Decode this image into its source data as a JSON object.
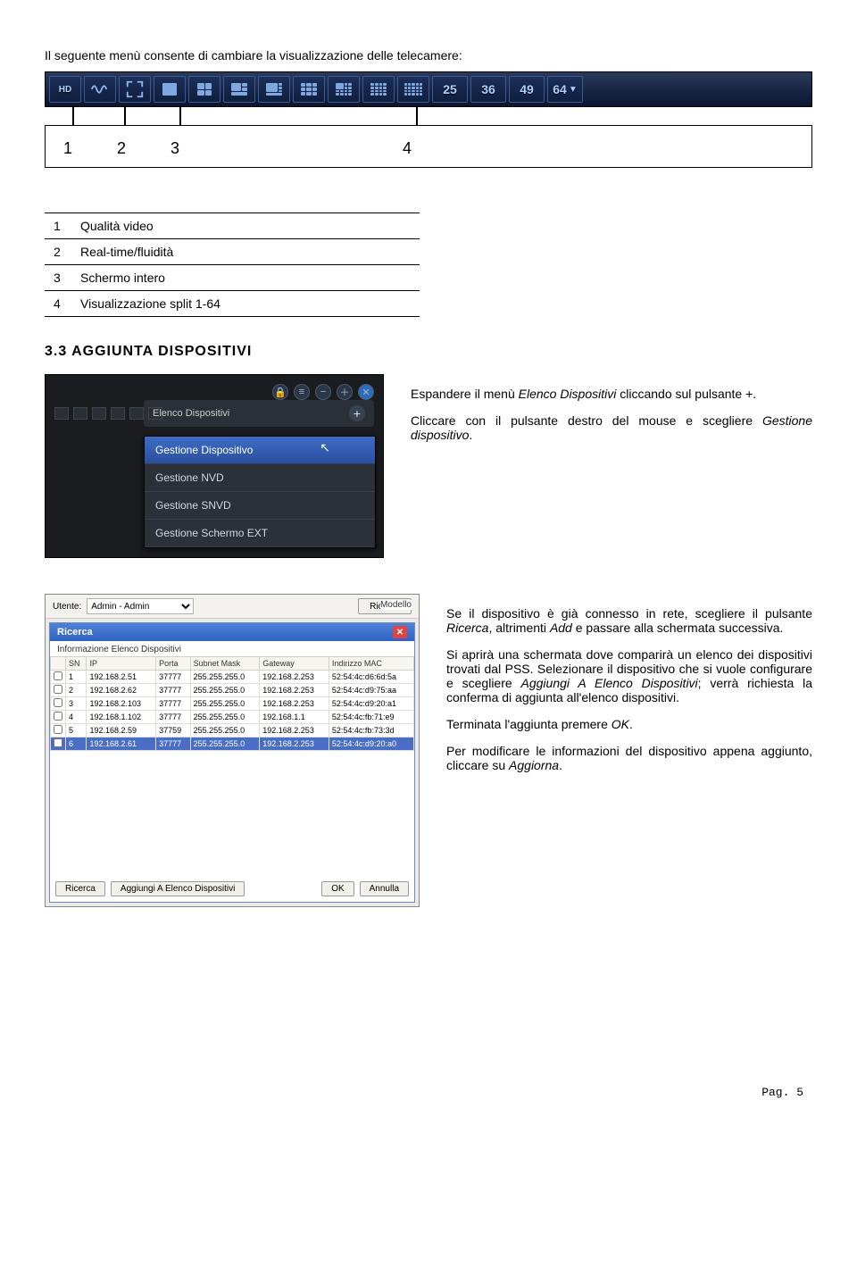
{
  "intro": "Il seguente menù consente di cambiare la visualizzazione delle telecamere:",
  "toolbar": {
    "hd": "HD",
    "numbers": [
      "25",
      "36",
      "49",
      "64"
    ]
  },
  "labels": {
    "n1": "1",
    "n2": "2",
    "n3": "3",
    "n4": "4"
  },
  "legend": [
    {
      "n": "1",
      "t": "Qualità video"
    },
    {
      "n": "2",
      "t": "Real-time/fluidità"
    },
    {
      "n": "3",
      "t": "Schermo intero"
    },
    {
      "n": "4",
      "t": "Visualizzazione split 1-64"
    }
  ],
  "sect_title": "3.3 AGGIUNTA DISPOSITIVI",
  "para1a": "Espandere il menù ",
  "para1b": "Elenco Dispositivi",
  "para1c": " cliccando sul pulsante +.",
  "para2a": "Cliccare con il pulsante destro del mouse e scegliere ",
  "para2b": "Gestione dispositivo",
  "para2c": ".",
  "elenco_head": "Elenco Dispositivi",
  "ctx": [
    "Gestione Dispositivo",
    "Gestione NVD",
    "Gestione SNVD",
    "Gestione Schermo EXT"
  ],
  "win": {
    "utente_label": "Utente:",
    "utente_val": "Admin - Admin",
    "ricerca_btn": "Ricerca",
    "modello": "Modello"
  },
  "dlg": {
    "title": "Ricerca",
    "subtitle": "Informazione Elenco Dispositivi",
    "headers": [
      "SN",
      "IP",
      "Porta",
      "Subnet Mask",
      "Gateway",
      "Indirizzo MAC"
    ],
    "rows": [
      {
        "sn": "1",
        "ip": "192.168.2.51",
        "port": "37777",
        "mask": "255.255.255.0",
        "gw": "192.168.2.253",
        "mac": "52:54:4c:d6:6d:5a"
      },
      {
        "sn": "2",
        "ip": "192.168.2.62",
        "port": "37777",
        "mask": "255.255.255.0",
        "gw": "192.168.2.253",
        "mac": "52:54:4c:d9:75:aa"
      },
      {
        "sn": "3",
        "ip": "192.168.2.103",
        "port": "37777",
        "mask": "255.255.255.0",
        "gw": "192.168.2.253",
        "mac": "52:54:4c:d9:20:a1"
      },
      {
        "sn": "4",
        "ip": "192.168.1.102",
        "port": "37777",
        "mask": "255.255.255.0",
        "gw": "192.168.1.1",
        "mac": "52:54:4c:fb:71:e9"
      },
      {
        "sn": "5",
        "ip": "192.168.2.59",
        "port": "37759",
        "mask": "255.255.255.0",
        "gw": "192.168.2.253",
        "mac": "52:54:4c:fb:73:3d"
      },
      {
        "sn": "6",
        "ip": "192.168.2.61",
        "port": "37777",
        "mask": "255.255.255.0",
        "gw": "192.168.2.253",
        "mac": "52:54:4c:d9:20:a0"
      }
    ],
    "btn_ricerca": "Ricerca",
    "btn_aggiungi": "Aggiungi A Elenco Dispositivi",
    "btn_ok": "OK",
    "btn_annulla": "Annulla"
  },
  "p3_parts": [
    "Se il dispositivo è già connesso in rete, scegliere il pulsante ",
    "Ricerca",
    ", altrimenti ",
    "Add",
    " e passare alla schermata successiva."
  ],
  "p4_parts": [
    "Si aprirà una schermata dove comparirà un elenco dei dispositivi trovati dal PSS. Selezionare il dispositivo che si vuole configurare e scegliere ",
    "Aggiungi A Elenco Dispositivi",
    "; verrà richiesta la conferma di aggiunta all'elenco dispositivi."
  ],
  "p5_parts": [
    "Terminata l'aggiunta premere ",
    "OK",
    "."
  ],
  "p6_parts": [
    "Per modificare le informazioni del dispositivo appena aggiunto, cliccare su ",
    "Aggiorna",
    "."
  ],
  "footer": "Pag. 5"
}
